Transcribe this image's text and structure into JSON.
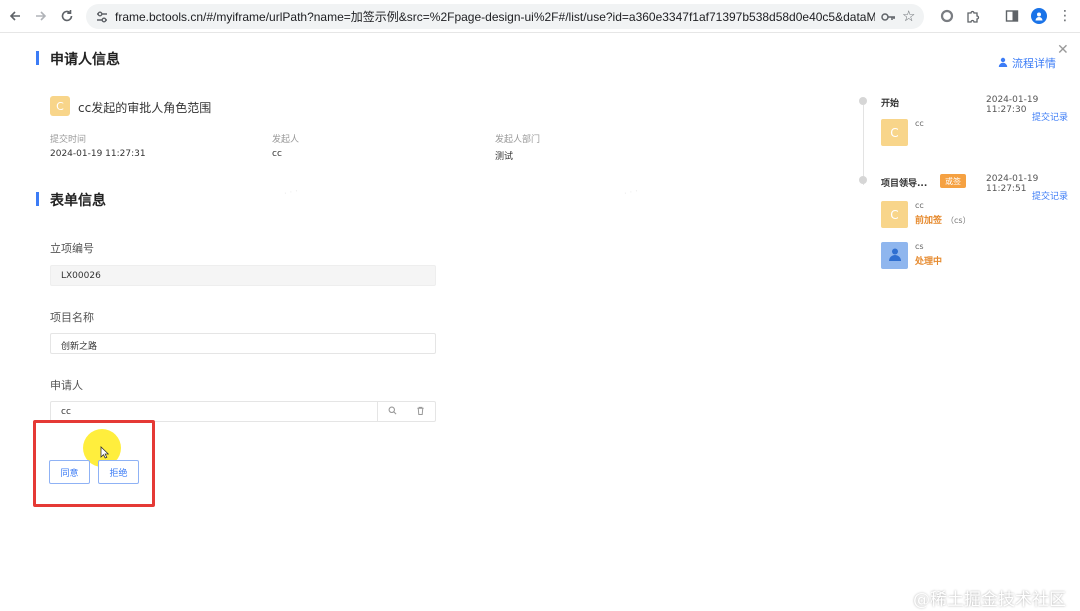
{
  "browser": {
    "url": "frame.bctools.cn/#/myiframe/urlPath?name=加签示例&src=%2Fpage-design-ui%2F#/list/use?id=a360e3347f1af71397b538d58d0e40c5&dataModelId..."
  },
  "applicant_section": {
    "title": "申请人信息",
    "flow_detail_link": "流程详情",
    "task_icon_letter": "C",
    "task_title": "cc发起的审批人角色范围",
    "meta": [
      {
        "label": "提交时间",
        "value": "2024-01-19 11:27:31"
      },
      {
        "label": "发起人",
        "value": "cc"
      },
      {
        "label": "发起人部门",
        "value": "测试"
      }
    ]
  },
  "form_section": {
    "title": "表单信息",
    "fields": [
      {
        "label": "立项编号",
        "value": "LX00026"
      },
      {
        "label": "项目名称",
        "value": "创新之路"
      },
      {
        "label": "申请人",
        "value": "cc"
      }
    ],
    "buttons": {
      "agree": "同意",
      "reject": "拒绝"
    }
  },
  "timeline": {
    "nodes": [
      {
        "name": "开始",
        "time": "2024-01-19 11:27:30",
        "link": "提交记录",
        "entries": [
          {
            "avatar": "C",
            "user": "cc",
            "action": ""
          }
        ]
      },
      {
        "name": "项目领导...",
        "tag": "或签",
        "time": "2024-01-19 11:27:51",
        "link": "提交记录",
        "entries": [
          {
            "avatar": "C",
            "user": "cc",
            "action": "前加签",
            "action_sub": "（cs）"
          },
          {
            "avatar": "",
            "user": "cs",
            "action": "处理中"
          }
        ]
      }
    ]
  },
  "footer_watermark": "@稀土掘金技术社区",
  "colors": {
    "accent": "#3c7cf6",
    "highlight": "#e53935",
    "warning": "#e68a2e",
    "avatar_yellow": "#f8d58a"
  }
}
